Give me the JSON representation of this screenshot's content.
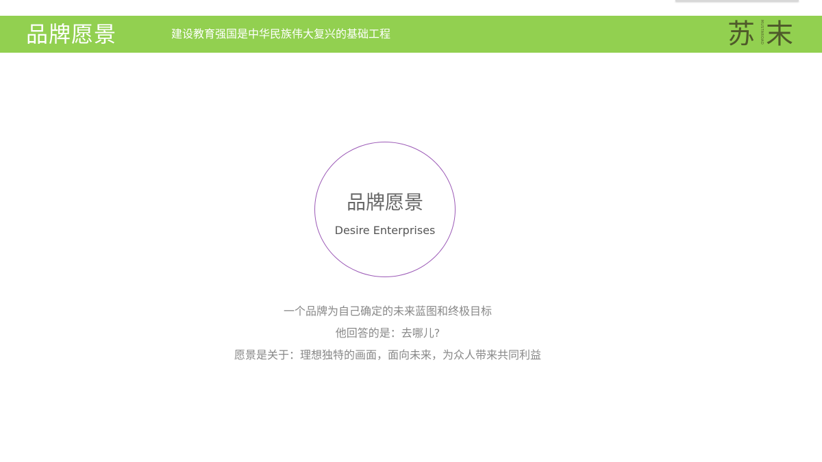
{
  "header": {
    "title": "品牌愿景",
    "slogan": "建设教育强国是中华民族伟大复兴的基础工程",
    "band_color": "#92d050"
  },
  "logo": {
    "char1": "苏",
    "char2": "末",
    "vertical_text": "MUSTAROAD",
    "color": "#4f5a2a"
  },
  "circle": {
    "title": "品牌愿景",
    "subtitle": "Desire Enterprises",
    "border_color": "#9b59b6"
  },
  "description": {
    "lines": [
      "一个品牌为自己确定的未来蓝图和终极目标",
      "他回答的是：去哪儿?",
      "愿景是关于：理想独特的画面，面向未来，为众人带来共同利益"
    ]
  }
}
